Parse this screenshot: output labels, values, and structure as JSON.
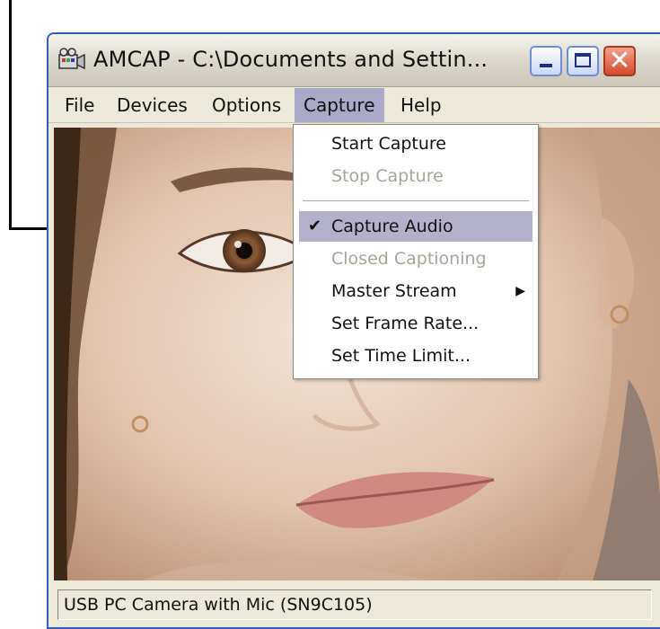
{
  "window": {
    "title": "AMCAP - C:\\Documents and Settin...",
    "title_icon": "camera-app-icon",
    "controls": [
      "minimize",
      "maximize",
      "close"
    ]
  },
  "menubar": {
    "items": [
      {
        "label": "File"
      },
      {
        "label": "Devices"
      },
      {
        "label": "Options"
      },
      {
        "label": "Capture",
        "active": true
      },
      {
        "label": "Help"
      }
    ]
  },
  "capture_menu": {
    "items": [
      {
        "label": "Start Capture",
        "enabled": true
      },
      {
        "label": "Stop Capture",
        "enabled": false
      },
      {
        "label": "Capture Audio",
        "enabled": true,
        "checked": true,
        "highlighted": true
      },
      {
        "label": "Closed Captioning",
        "enabled": false
      },
      {
        "label": "Master Stream",
        "enabled": true,
        "submenu": true
      },
      {
        "label": "Set Frame Rate...",
        "enabled": true
      },
      {
        "label": "Set Time Limit...",
        "enabled": true
      }
    ]
  },
  "statusbar": {
    "text": "USB PC Camera with Mic (SN9C105)"
  },
  "colors": {
    "title_close": "#d44a2c",
    "menu_highlight": "#b3b0cc",
    "window_border": "#2e5fbf"
  }
}
